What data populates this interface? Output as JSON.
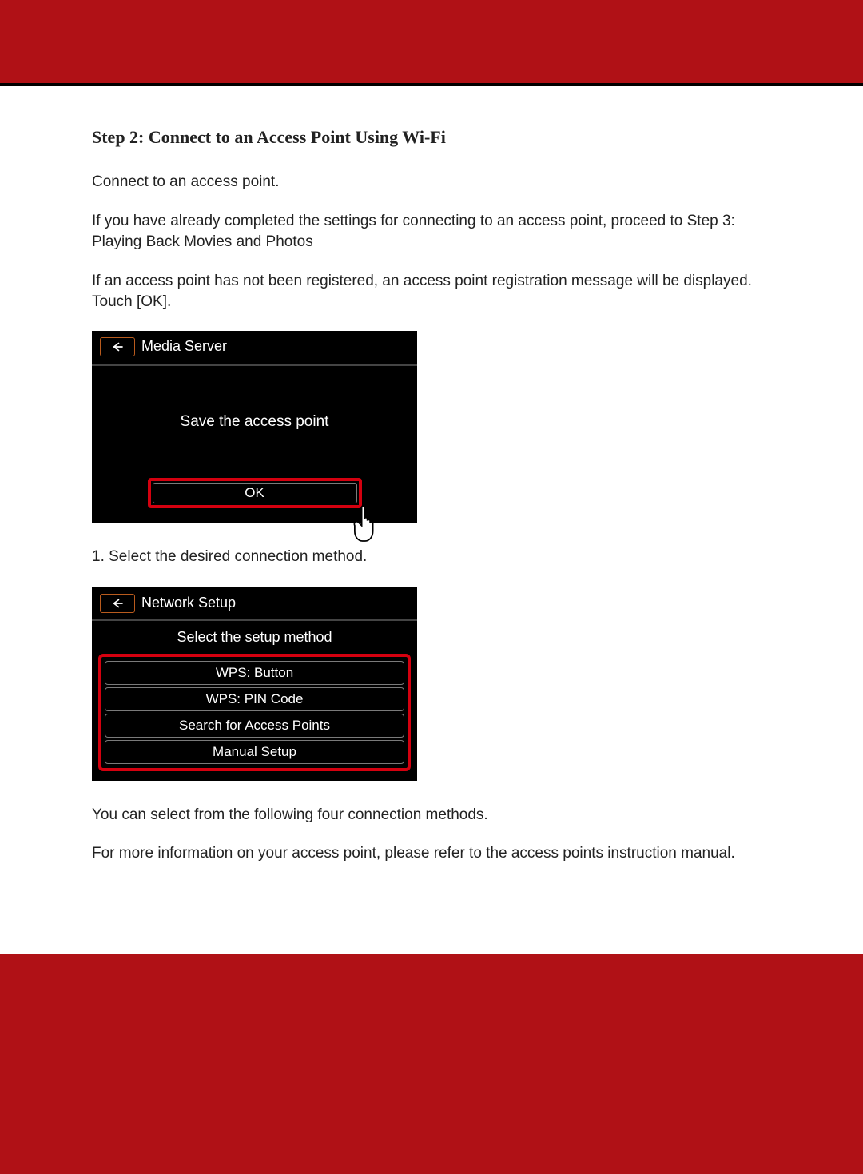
{
  "step_title": "Step 2: Connect to an Access Point Using Wi-Fi",
  "para1": "Connect to an access point.",
  "para2": "If you have already completed the settings for connecting to an access point, proceed to Step 3: Playing Back Movies and Photos",
  "para3": "If an access point has not been registered, an access point registration message will be displayed. Touch [OK].",
  "screen1": {
    "title": "Media Server",
    "message": "Save the access point",
    "ok": "OK"
  },
  "para4": "1. Select the desired connection method.",
  "screen2": {
    "title": "Network Setup",
    "subtitle": "Select the setup method",
    "options": {
      "0": "WPS: Button",
      "1": "WPS: PIN Code",
      "2": "Search for Access Points",
      "3": "Manual Setup"
    }
  },
  "para5": "You can select from the following four connection methods.",
  "para6": "For more information on your access point, please refer to the access points instruction manual."
}
